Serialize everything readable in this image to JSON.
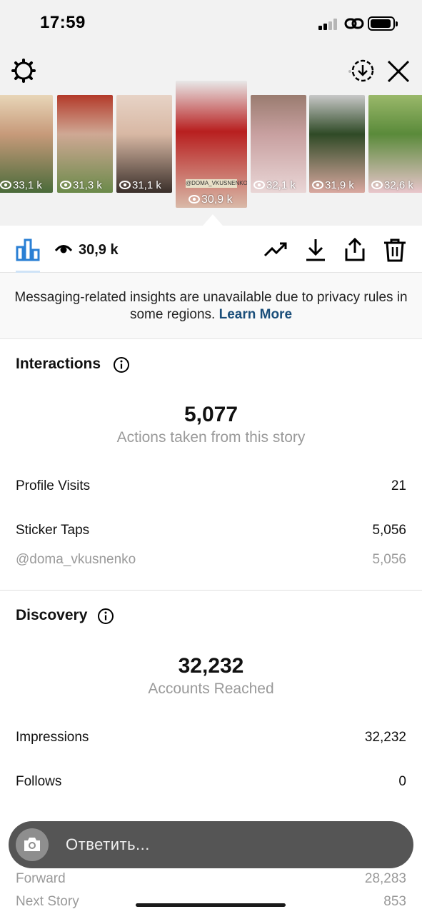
{
  "status_bar": {
    "time": "17:59"
  },
  "story_strip": {
    "items": [
      {
        "views": "33,1 k",
        "colors": [
          "#c79a7a",
          "#4a6b3a",
          "#e8d6b8"
        ]
      },
      {
        "views": "31,3 k",
        "colors": [
          "#cfa894",
          "#6b8a4a",
          "#b33a2a"
        ]
      },
      {
        "views": "31,1 k",
        "colors": [
          "#d8b8a4",
          "#3a2f2a",
          "#e7d3c6"
        ]
      },
      {
        "views": "30,9 k",
        "colors": [
          "#b81f1f",
          "#d9b9a8",
          "#e8e8e8"
        ],
        "active": true
      },
      {
        "views": "32,1 k",
        "colors": [
          "#c8a0a0",
          "#e9d6d6",
          "#9a7c70"
        ]
      },
      {
        "views": "31,9 k",
        "colors": [
          "#2f4a26",
          "#d9a8a0",
          "#c8c8c8"
        ]
      },
      {
        "views": "32,6 k",
        "colors": [
          "#5a8a3a",
          "#e9c6cc",
          "#9ab86a"
        ]
      }
    ],
    "active_tag": "@DOMA_VKUSNENKO"
  },
  "toolbar": {
    "views": "30,9 k"
  },
  "notice": {
    "text": "Messaging-related insights are unavailable due to privacy rules in some regions.",
    "link": "Learn More"
  },
  "interactions": {
    "title": "Interactions",
    "total": "5,077",
    "caption": "Actions taken from this story",
    "rows": [
      {
        "label": "Profile Visits",
        "value": "21"
      },
      {
        "label": "Sticker Taps",
        "value": "5,056"
      },
      {
        "label": "@doma_vkusnenko",
        "value": "5,056"
      }
    ]
  },
  "discovery": {
    "title": "Discovery",
    "total": "32,232",
    "caption": "Accounts Reached",
    "rows": [
      {
        "label": "Impressions",
        "value": "32,232"
      },
      {
        "label": "Follows",
        "value": "0"
      },
      {
        "label": "Forward",
        "value": "28,283"
      },
      {
        "label": "Next Story",
        "value": "853"
      }
    ]
  },
  "reply": {
    "placeholder": "Ответить..."
  }
}
